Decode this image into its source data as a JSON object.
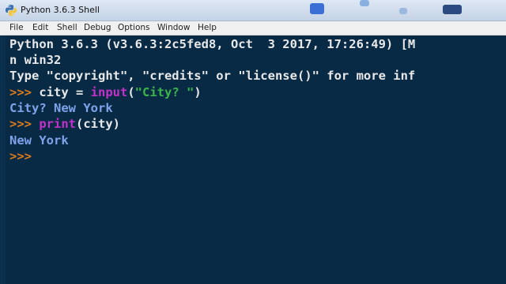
{
  "window": {
    "title": "Python 3.6.3 Shell"
  },
  "menubar": {
    "items": [
      "File",
      "Edit",
      "Shell",
      "Debug",
      "Options",
      "Window",
      "Help"
    ]
  },
  "shell": {
    "banner_line1": "Python 3.6.3 (v3.6.3:2c5fed8, Oct  3 2017, 17:26:49) [M",
    "banner_line2": "n win32",
    "banner_line3": "Type \"copyright\", \"credits\" or \"license()\" for more inf",
    "cmd1": {
      "prompt": ">>>",
      "pre": " city = ",
      "func": "input",
      "open": "(",
      "string": "\"City? \"",
      "close": ")"
    },
    "output1": "City? New York",
    "cmd2": {
      "prompt": ">>>",
      "sp": " ",
      "func": "print",
      "rest": "(city)"
    },
    "output2": "New York",
    "cmd3": {
      "prompt": ">>>"
    }
  },
  "colors": {
    "shell_background": "#082a45",
    "prompt": "#d97a1d",
    "builtin": "#c231c8",
    "string": "#39b54a",
    "stdout": "#7fa3ea",
    "text": "#e8e8e8"
  }
}
